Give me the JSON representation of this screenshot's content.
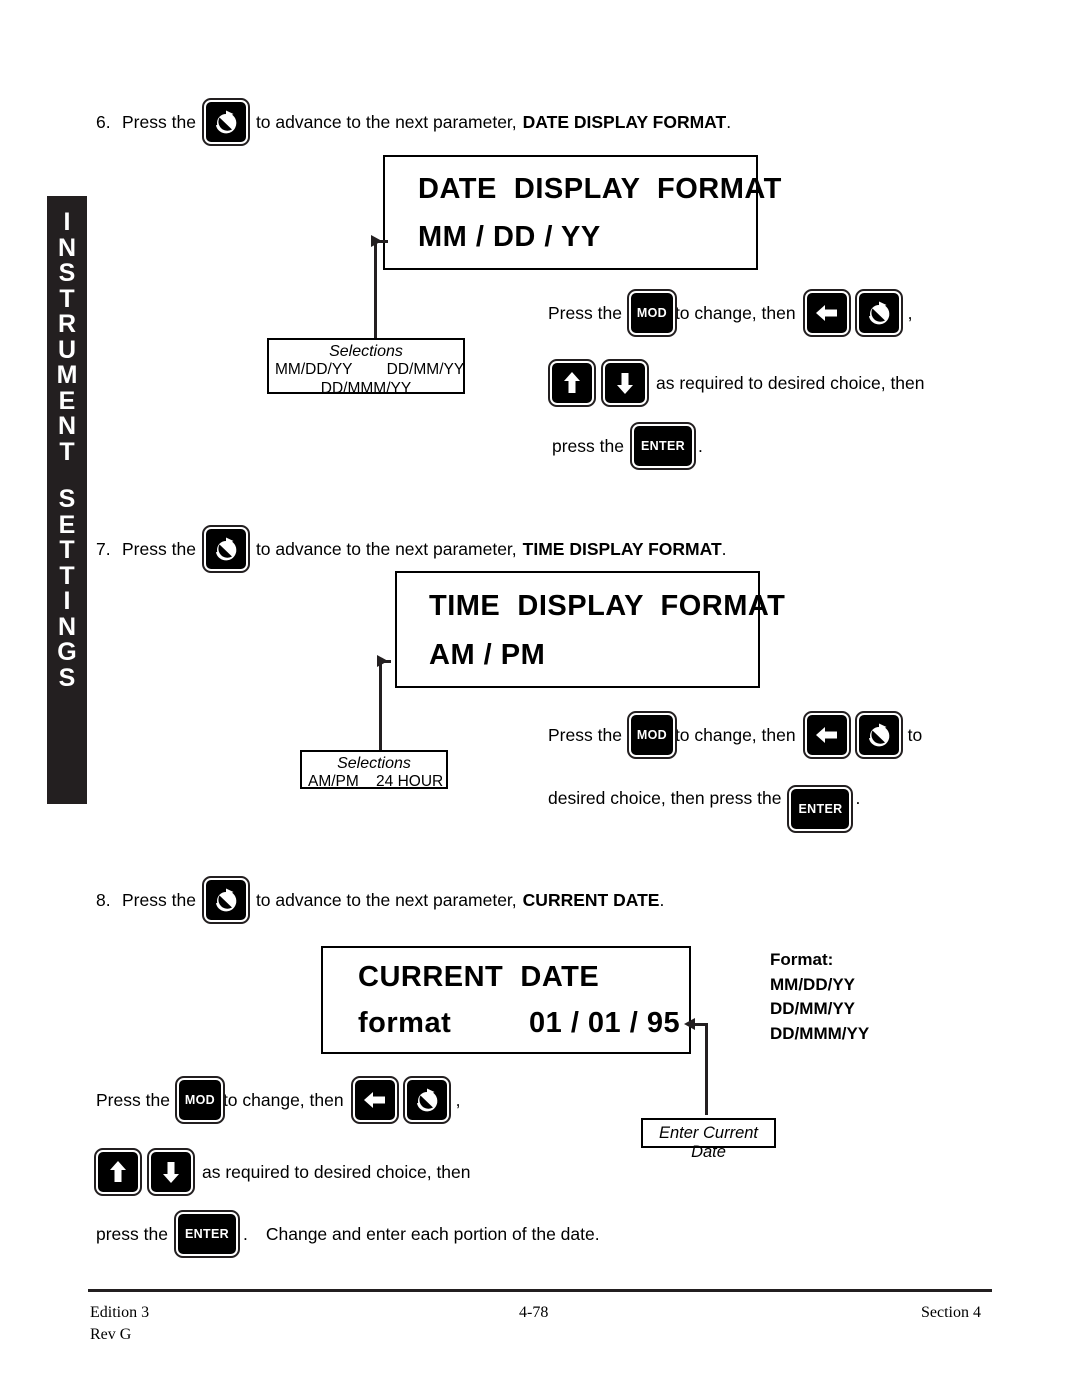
{
  "side_tab": {
    "line1": "INSTRUMENT",
    "line2": "SETTINGS"
  },
  "steps": [
    {
      "number": "6.",
      "text_before": "Press the",
      "text_middle": "to advance to the next parameter,",
      "parameter": "DATE DISPLAY FORMAT",
      "period": ".",
      "key_icon": "rotate-advance-icon"
    },
    {
      "number": "7.",
      "text_before": "Press the",
      "text_middle": "to advance to the next parameter,",
      "parameter": "TIME DISPLAY FORMAT",
      "period": ".",
      "key_icon": "rotate-advance-icon"
    },
    {
      "number": "8.",
      "text_before": "Press the",
      "text_middle": "to advance to the next parameter,",
      "parameter": "CURRENT DATE",
      "period": ".",
      "key_icon": "rotate-advance-icon"
    }
  ],
  "displays": [
    {
      "id": "date-display-format",
      "line1": "DATE  DISPLAY  FORMAT",
      "line2": "MM / DD / YY"
    },
    {
      "id": "time-display-format",
      "line1": "TIME  DISPLAY  FORMAT",
      "line2": "AM / PM"
    },
    {
      "id": "current-date",
      "line1": "CURRENT  DATE",
      "line2_label": "format",
      "line2_value": "01 / 01 / 95"
    }
  ],
  "selections": [
    {
      "id": "date-format-selections",
      "caption": "Selections",
      "row1": "MM/DD/YY        DD/MM/YY",
      "row2": "DD/MMM/YY"
    },
    {
      "id": "time-format-selections",
      "caption": "Selections",
      "row1": "AM/PM    24 HOUR"
    }
  ],
  "enter_date_callout": {
    "label": "Enter Current Date"
  },
  "format_list": {
    "heading": "Format:",
    "items": [
      "MM/DD/YY",
      "DD/MM/YY",
      "DD/MMM/YY"
    ]
  },
  "instructions": {
    "date": {
      "l1_a": "Press the",
      "l1_b": "to change, then",
      "l1_c": ",",
      "l2_a": "as required to desired choice, then",
      "l3_a": "press  the",
      "l3_b": ".",
      "mod_label": "MOD",
      "enter_label": "ENTER"
    },
    "time": {
      "l1_a": "Press the",
      "l1_b": "to change, then",
      "l1_c": "to",
      "l2_a": "desired choice, then press the",
      "l2_b": ".",
      "mod_label": "MOD",
      "enter_label": "ENTER"
    },
    "current_date": {
      "l1_a": "Press the",
      "l1_b": "to change, then",
      "l1_c": ",",
      "l2_a": "as required to desired choice, then",
      "l3_a": "press  the",
      "l3_b": ".",
      "l3_c": "Change and enter each portion of the date.",
      "mod_label": "MOD",
      "enter_label": "ENTER"
    }
  },
  "footer": {
    "edition": "Edition 3",
    "revision": "Rev G",
    "page_number": "4-78",
    "section": "Section 4"
  },
  "colors": {
    "ink": "#231f20",
    "paper": "#ffffff",
    "key_face": "#000000"
  }
}
